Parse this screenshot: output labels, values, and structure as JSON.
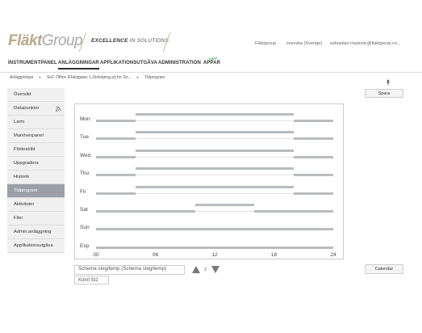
{
  "brand": {
    "logo_main": "Fläkt",
    "logo_group": "Group",
    "tagline_bold": "EXCELLENCE",
    "tagline_rest": " IN SOLUTIONS"
  },
  "topbar": {
    "company": "Fläktgroup",
    "language": "svenska (Sverige)",
    "user": "sebastian.madunic@flaktgroup.co..."
  },
  "nav": {
    "items": [
      {
        "label": "INSTRUMENTPANEL"
      },
      {
        "label": "ANLÄGGNINGAR"
      },
      {
        "label": "APPLIKATIONSUTGÅVA"
      },
      {
        "label": "ADMINISTRATION"
      },
      {
        "label": "APPAR"
      }
    ],
    "new_badge": "New"
  },
  "breadcrumb": [
    "Anläggningar",
    "SnC Office (Fläktgatan 1,Jönköping,st) for Sn...",
    "Tidprogram"
  ],
  "actions": {
    "save_label": "Spara",
    "calendar_label": "Calendar"
  },
  "sidebar": {
    "items": [
      {
        "label": "Översikt"
      },
      {
        "label": "Datapunkter"
      },
      {
        "label": "Larm"
      },
      {
        "label": "Manöverpanel"
      },
      {
        "label": "Flödesbild"
      },
      {
        "label": "Uppgradera"
      },
      {
        "label": "Historik"
      },
      {
        "label": "Tidprogram"
      },
      {
        "label": "Aktiviteter"
      },
      {
        "label": "Filer"
      },
      {
        "label": "Admin.anläggning"
      },
      {
        "label": "Applikationsutgåva"
      }
    ]
  },
  "schedule": {
    "days": [
      "Mon",
      "Tue",
      "Wed",
      "Thu",
      "Fri",
      "Sat",
      "Sun",
      "Exp"
    ],
    "ticks": [
      "00",
      "06",
      "12",
      "18",
      "24"
    ],
    "rows": [
      [
        [
          0,
          4
        ],
        [
          4,
          20
        ],
        [
          20,
          24
        ]
      ],
      [
        [
          0,
          4
        ],
        [
          4,
          20
        ],
        [
          20,
          24
        ]
      ],
      [
        [
          0,
          4
        ],
        [
          4,
          20
        ],
        [
          20,
          24
        ]
      ],
      [
        [
          0,
          4
        ],
        [
          4,
          20
        ],
        [
          20,
          24
        ]
      ],
      [
        [
          0,
          4
        ],
        [
          4,
          20
        ],
        [
          20,
          24
        ]
      ],
      [
        [
          0,
          10
        ],
        [
          10,
          16
        ],
        [
          16,
          24
        ]
      ],
      [
        [
          0,
          24
        ]
      ],
      [
        [
          0,
          24
        ]
      ]
    ]
  },
  "controls": {
    "schema_label": "Schema steg/temp (Schema steg/temp)",
    "komf_label": "Komf.St2",
    "step_value": "2"
  },
  "colors": {
    "bar": "#b9bcbf",
    "active_sidebar": "#9aa0a6"
  }
}
